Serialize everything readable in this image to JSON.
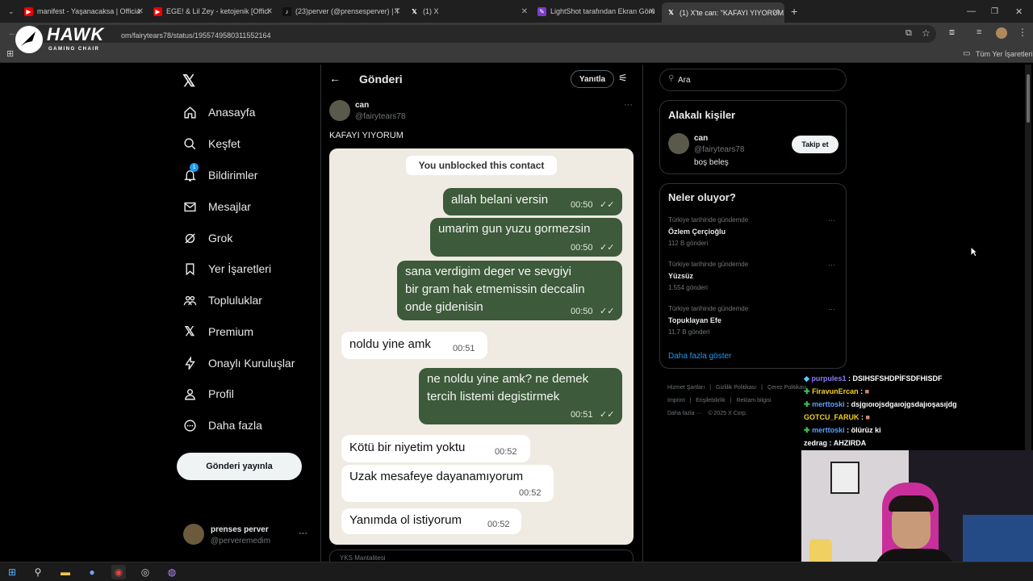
{
  "browser": {
    "tabs": [
      {
        "title": "manifest - Yaşanacaksa | Officia",
        "icon": "youtube"
      },
      {
        "title": "EGE! & Lil Zey - ketojenik [Offici",
        "icon": "youtube"
      },
      {
        "title": "(23)perver (@prensesperver) | T",
        "icon": "tiktok"
      },
      {
        "title": "(1) X",
        "icon": "x"
      },
      {
        "title": "LightShot tarafından Ekran Görü",
        "icon": "lightshot"
      },
      {
        "title": "(1) X'te can: \"KAFAYI YIYORUM",
        "icon": "x"
      }
    ],
    "url": "om/fairytears78/status/1955749580311552164",
    "bookmarks_label": "Tüm Yer İşaretleri"
  },
  "brand": {
    "name": "HAWK",
    "tagline": "GAMING CHAIR"
  },
  "nav": {
    "items": [
      {
        "label": "Anasayfa",
        "icon": "home-icon"
      },
      {
        "label": "Keşfet",
        "icon": "search-icon"
      },
      {
        "label": "Bildirimler",
        "icon": "bell-icon",
        "badge": "1"
      },
      {
        "label": "Mesajlar",
        "icon": "mail-icon"
      },
      {
        "label": "Grok",
        "icon": "grok-icon"
      },
      {
        "label": "Yer İşaretleri",
        "icon": "bookmark-icon"
      },
      {
        "label": "Topluluklar",
        "icon": "people-icon"
      },
      {
        "label": "Premium",
        "icon": "x-icon"
      },
      {
        "label": "Onaylı Kuruluşlar",
        "icon": "bolt-icon"
      },
      {
        "label": "Profil",
        "icon": "person-icon"
      },
      {
        "label": "Daha fazla",
        "icon": "more-circle-icon"
      }
    ],
    "post_button": "Gönderi yayınla",
    "profile": {
      "name": "prenses perver",
      "handle": "@perveremedim",
      "more": "···"
    }
  },
  "post": {
    "header_title": "Gönderi",
    "reply_button": "Yanıtla",
    "author_name": "can",
    "author_handle": "@fairytears78",
    "more": "···",
    "text": "KAFAYI YIYORUM",
    "next_hint": "YKS Mantalitesi"
  },
  "chat_screenshot": {
    "system_note": "You unblocked this contact",
    "messages": [
      {
        "dir": "out",
        "text": "allah belani versin",
        "time": "00:50"
      },
      {
        "dir": "out",
        "text": "umarim gun yuzu gormezsin",
        "time": "00:50"
      },
      {
        "dir": "out",
        "line1": "sana verdigim deger ve sevgiyi",
        "line2": "bir gram hak etmemissin deccalin",
        "line3": "onde gidenisin",
        "time": "00:50"
      },
      {
        "dir": "in",
        "text": "noldu yine amk",
        "time": "00:51"
      },
      {
        "dir": "out",
        "line1": "ne noldu yine amk? ne demek",
        "line2": "tercih listemi degistirmek",
        "time": "00:51"
      },
      {
        "dir": "in",
        "text": "Kötü bir niyetim yoktu",
        "time": "00:52"
      },
      {
        "dir": "in",
        "text": "Uzak mesafeye dayanamıyorum",
        "time": "00:52"
      },
      {
        "dir": "in",
        "text": "Yanımda ol istiyorum",
        "time": "00:52"
      }
    ]
  },
  "right": {
    "search_placeholder": "Ara",
    "relevant": {
      "title": "Alakalı kişiler",
      "name": "can",
      "handle": "@fairytears78",
      "bio": "boş beleş",
      "follow": "Takip et"
    },
    "trends": {
      "title": "Neler oluyor?",
      "items": [
        {
          "context": "Türkiye tarihinde gündemde",
          "name": "Özlem Çerçioğlu",
          "count": "112 B gönderi"
        },
        {
          "context": "Türkiye tarihinde gündemde",
          "name": "Yüzsüz",
          "count": "1.554 gönderi"
        },
        {
          "context": "Türkiye tarihinde gündemde",
          "name": "Topuklayan Efe",
          "count": "11,7 B gönderi"
        }
      ],
      "more": "Daha fazla göster"
    },
    "footer": {
      "l1a": "Hizmet Şartları",
      "l1b": "Gizlilik Politikası",
      "l1c": "Çerez Politikası",
      "l2a": "Imprint",
      "l2b": "Erişilebilirlik",
      "l2c": "Reklam bilgisi",
      "l3a": "Daha fazla ···",
      "l3b": "© 2025 X Corp."
    }
  },
  "stream_chat": [
    {
      "user": "purpules1",
      "msg": ": DSIHSFSHDPİFSDFHISDF",
      "color": "#8b7bff"
    },
    {
      "user": "FiravunErcan",
      "msg": ":",
      "color": "#f0d020"
    },
    {
      "user": "merttoski",
      "msg": ": dsjgıoıojsdgaıojgsdajıoşasıjdg",
      "color": "#5aa0ff"
    },
    {
      "user": "GOTCU_FARUK",
      "msg": ":",
      "color": "#f0d020"
    },
    {
      "user": "merttoski",
      "msg": ": ölürüz ki",
      "color": "#5aa0ff"
    },
    {
      "user": "zedrag",
      "msg": ": AHZIRDA",
      "color": "#ffffff"
    }
  ],
  "colors": {
    "x_bg": "#000000",
    "border": "#2f3336",
    "link": "#1d9bf0",
    "wa_out": "#3d5a3a",
    "wa_bg": "#efeae2"
  }
}
